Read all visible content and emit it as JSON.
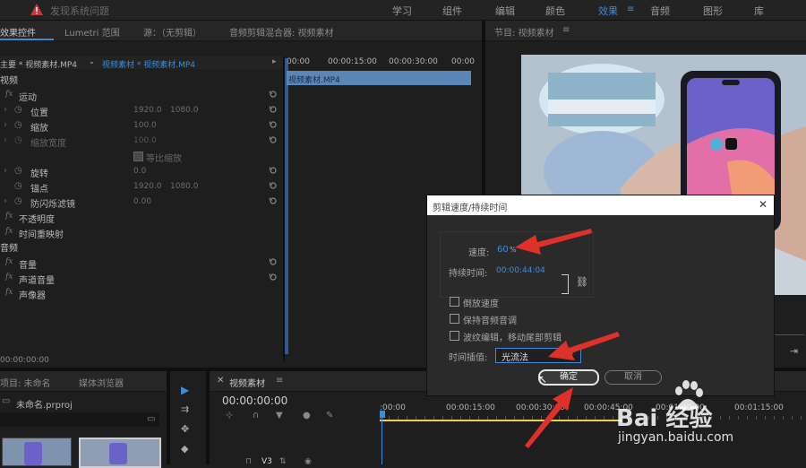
{
  "topbar": {
    "warning": "发现系统问题",
    "workspaces": [
      "学习",
      "组件",
      "编辑",
      "颜色",
      "效果",
      "音频",
      "图形",
      "库"
    ],
    "active_workspace": "效果"
  },
  "effect_controls": {
    "tabs": [
      "效果控件",
      "Lumetri 范围",
      "源：（无剪辑）",
      "音频剪辑混合器: 视频素材"
    ],
    "source_label": "主要 * 视频素材.MP4",
    "clip_label": "视频素材 * 视频素材.MP4",
    "ruler": [
      "00:00",
      "00:00:15:00",
      "00:00:30:00",
      "00:00"
    ],
    "clip_bar": "视频素材.MP4",
    "video_section": "视频",
    "motion": "运动",
    "position_label": "位置",
    "position_x": "1920.0",
    "position_y": "1080.0",
    "scale_label": "缩放",
    "scale_value": "100.0",
    "scale_width_label": "缩放宽度",
    "scale_width_value": "100.0",
    "uniform_label": "等比缩放",
    "rotation_label": "旋转",
    "rotation_value": "0.0",
    "anchor_label": "锚点",
    "anchor_x": "1920.0",
    "anchor_y": "1080.0",
    "flicker_label": "防闪烁滤镜",
    "flicker_value": "0.00",
    "opacity": "不透明度",
    "time_remap": "时间重映射",
    "audio_section": "音频",
    "volume": "音量",
    "channel_volume": "声道音量",
    "panner": "声像器",
    "timecode": "00:00:00:00"
  },
  "program": {
    "tab": "节目: 视频素材"
  },
  "project": {
    "tab": "项目: 未命名",
    "tab2": "媒体浏览器",
    "file": "未命名.prproj"
  },
  "timeline": {
    "tab": "视频素材",
    "timecode": "00:00:00:00",
    "ruler": [
      ":00:00",
      "00:00:15:00",
      "00:00:30:00",
      "00:00:45:00",
      "00:01:00:00",
      "00:01:15:00"
    ],
    "track": "V3"
  },
  "dialog": {
    "title": "剪辑速度/持续时间",
    "close": "✕",
    "speed_label": "速度:",
    "speed_value": "60",
    "speed_unit": "%",
    "duration_label": "持续时间:",
    "duration_value": "00:00:44:04",
    "reverse": "倒放速度",
    "maintain_pitch": "保持音频音调",
    "ripple": "波纹编辑，移动尾部剪辑",
    "interp_label": "时间插值:",
    "interp_value": "光流法",
    "ok": "确定",
    "cancel": "取消"
  },
  "watermark": {
    "brand": "Bai 经验",
    "url": "jingyan.baidu.com"
  }
}
